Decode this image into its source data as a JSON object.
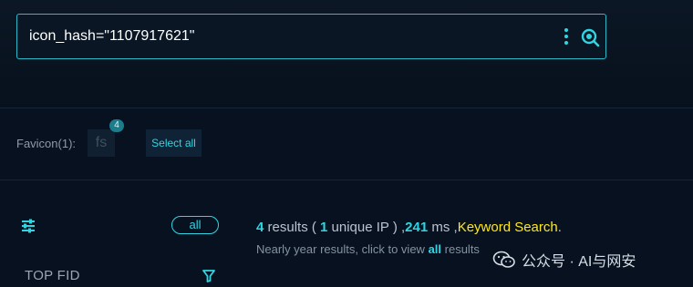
{
  "search": {
    "query": "icon_hash=\"1107917621\"",
    "more_icon": "more-vertical-icon",
    "search_icon": "search-icon"
  },
  "favicon": {
    "label": "Favicon(1):",
    "thumb_text": "fs",
    "badge": "4",
    "select_all": "Select all"
  },
  "sidebar": {
    "filter_icon": "sliders-icon",
    "all_label": "all",
    "top_fid_label": "TOP FID",
    "fid_filter_icon": "funnel-icon"
  },
  "results": {
    "count": "4",
    "count_label": " results ( ",
    "unique": "1",
    "unique_label": " unique IP ) ,",
    "ms": "241",
    "ms_label": " ms ,",
    "keyword_search": "Keyword Search",
    "period": ".",
    "sub_prefix": "Nearly year results, click to view ",
    "sub_link": "all",
    "sub_suffix": " results"
  },
  "watermark": {
    "text": "公众号 · AI与网安"
  },
  "colors": {
    "accent": "#2fd6e2",
    "keyword": "#ffe81a",
    "background": "#07111f"
  }
}
